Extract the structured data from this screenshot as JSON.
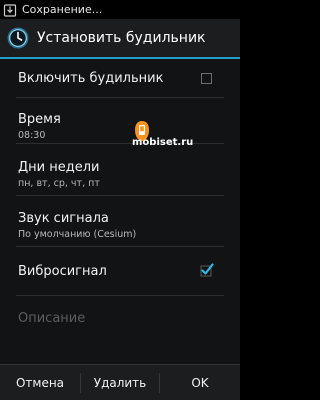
{
  "status_bar": {
    "text": "Сохранение...",
    "icon": "save-notification-icon"
  },
  "action_bar": {
    "title": "Установить будильник",
    "icon": "alarm-clock-icon"
  },
  "settings": {
    "enable_alarm": {
      "label": "Включить будильник",
      "checked": false
    },
    "time": {
      "label": "Время",
      "value": "08:30"
    },
    "days": {
      "label": "Дни недели",
      "value": "пн, вт, ср, чт, пт"
    },
    "sound": {
      "label": "Звук сигнала",
      "value": "По умолчанию (Cesium)"
    },
    "vibrate": {
      "label": "Вибросигнал",
      "checked": true
    },
    "description": {
      "placeholder": "Описание"
    }
  },
  "watermark": {
    "text": "mobiset.ru"
  },
  "buttons": {
    "cancel": "Отмена",
    "delete": "Удалить",
    "ok": "OK"
  },
  "colors": {
    "accent": "#33b5e5",
    "watermark_logo": "#f7931e"
  }
}
